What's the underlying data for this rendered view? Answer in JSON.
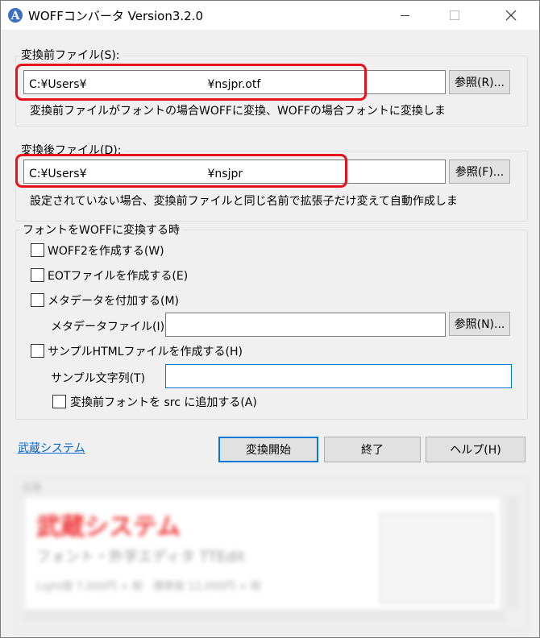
{
  "window": {
    "title": "WOFFコンバータ Version3.2.0"
  },
  "source": {
    "group_label": "変換前ファイル(S):",
    "path_prefix": "C:¥Users¥",
    "path_redacted": "　　　　　　　　　　",
    "path_suffix": "¥nsjpr.otf",
    "browse_label": "参照(R)...",
    "hint": "変換前ファイルがフォントの場合WOFFに変換、WOFFの場合フォントに変換しま"
  },
  "dest": {
    "group_label": "変換後ファイル(D):",
    "path_prefix": "C:¥Users¥",
    "path_redacted": "　　　　　　　　　　",
    "path_suffix": "¥nsjpr",
    "browse_label": "参照(F)...",
    "hint": "設定されていない場合、変換前ファイルと同じ名前で拡張子だけ変えて自動作成しま"
  },
  "options": {
    "group_label": "フォントをWOFFに変換する時",
    "woff2_label": "WOFF2を作成する(W)",
    "eot_label": "EOTファイルを作成する(E)",
    "meta_label": "メタデータを付加する(M)",
    "meta_file_label": "メタデータファイル(I)",
    "meta_file_value": "",
    "meta_browse_label": "参照(N)...",
    "sample_html_label": "サンプルHTMLファイルを作成する(H)",
    "sample_text_label": "サンプル文字列(T)",
    "sample_text_value": "",
    "add_src_label": "変換前フォントを src に追加する(A)"
  },
  "footer": {
    "link": "武蔵システム",
    "convert_label": "変換開始",
    "exit_label": "終了",
    "help_label": "ヘルプ(H)"
  },
  "preview": {
    "label": "広告",
    "title": "武蔵システム",
    "subtitle": "フォント・外字エディタ TTEdit",
    "line": "Light版 7,000円 + 税　標準版 12,000円 + 税"
  },
  "colors": {
    "highlight": "#e8121c",
    "link": "#0066cc",
    "focus": "#0078d7"
  }
}
